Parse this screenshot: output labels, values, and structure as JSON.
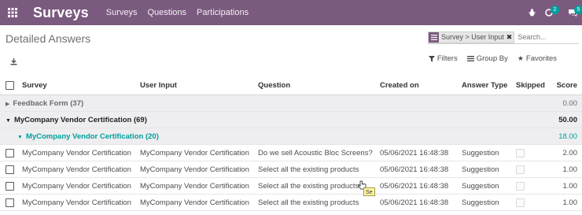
{
  "navbar": {
    "app_icon": "grid-icon",
    "brand": "Surveys",
    "menu": [
      "Surveys",
      "Questions",
      "Participations"
    ],
    "chat_badge": "2",
    "activity_badge": "5",
    "color": "#7b5a7f"
  },
  "control_panel": {
    "title": "Detailed Answers",
    "facet": "Survey > User Input",
    "search_placeholder": "Search...",
    "filters_label": "Filters",
    "groupby_label": "Group By",
    "favorites_label": "Favorites"
  },
  "table": {
    "headers": {
      "survey": "Survey",
      "user_input": "User Input",
      "question": "Question",
      "created_on": "Created on",
      "answer_type": "Answer Type",
      "skipped": "Skipped",
      "score": "Score"
    },
    "groups": [
      {
        "label": "Feedback Form (37)",
        "score": "0.00",
        "expanded": false
      },
      {
        "label": "MyCompany Vendor Certification (69)",
        "score": "50.00",
        "expanded": true
      },
      {
        "label": "MyCompany Vendor Certification (20)",
        "score": "18.00",
        "expanded": true
      }
    ],
    "rows": [
      {
        "survey": "MyCompany Vendor Certification",
        "user_input": "MyCompany Vendor Certification",
        "question": "Do we sell Acoustic Bloc Screens?",
        "created_on": "05/06/2021 16:48:38",
        "answer_type": "Suggestion",
        "score": "2.00"
      },
      {
        "survey": "MyCompany Vendor Certification",
        "user_input": "MyCompany Vendor Certification",
        "question": "Select all the existing products",
        "created_on": "05/06/2021 16:48:38",
        "answer_type": "Suggestion",
        "score": "1.00"
      },
      {
        "survey": "MyCompany Vendor Certification",
        "user_input": "MyCompany Vendor Certification",
        "question": "Select all the existing products",
        "created_on": "05/06/2021 16:48:38",
        "answer_type": "Suggestion",
        "score": "1.00"
      },
      {
        "survey": "MyCompany Vendor Certification",
        "user_input": "MyCompany Vendor Certification",
        "question": "Select all the existing products",
        "created_on": "05/06/2021 16:48:38",
        "answer_type": "Suggestion",
        "score": "1.00"
      }
    ]
  },
  "tooltip": "Se"
}
